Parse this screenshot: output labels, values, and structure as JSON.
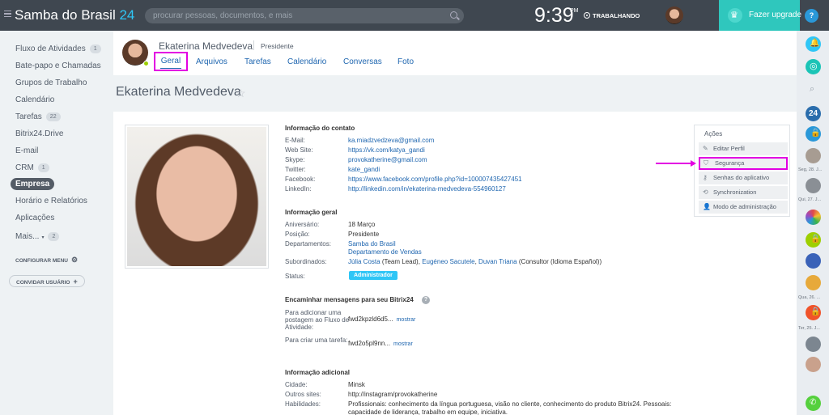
{
  "header": {
    "logo_text": "Samba do Brasil",
    "logo_number": "24",
    "search_placeholder": "procurar pessoas, documentos, e mais",
    "time": "9:39",
    "ampm": "PM",
    "work_status": "TRABALHANDO",
    "upgrade_label": "Fazer upgrade",
    "help_label": "?"
  },
  "sidebar": {
    "items": [
      {
        "label": "Fluxo de Atividades",
        "count": "1"
      },
      {
        "label": "Bate-papo e Chamadas"
      },
      {
        "label": "Grupos de Trabalho"
      },
      {
        "label": "Calendário"
      },
      {
        "label": "Tarefas",
        "count": "22"
      },
      {
        "label": "Bitrix24.Drive"
      },
      {
        "label": "E-mail"
      },
      {
        "label": "CRM",
        "count": "1"
      },
      {
        "label": "Empresa"
      },
      {
        "label": "Horário e Relatórios"
      },
      {
        "label": "Aplicações"
      },
      {
        "label": "Mais...",
        "count": "2"
      }
    ],
    "configure_label": "CONFIGURAR MENU",
    "invite_label": "CONVIDAR USUÁRIO"
  },
  "profile": {
    "name": "Ekaterina Medvedeva",
    "position": "Presidente",
    "tabs": [
      "Geral",
      "Arquivos",
      "Tarefas",
      "Calendário",
      "Conversas",
      "Foto"
    ],
    "title": "Ekaterina Medvedeva"
  },
  "contact": {
    "title": "Informação do contato",
    "rows": [
      {
        "label": "E-Mail:",
        "value": "ka.miadzvedzeva@gmail.com"
      },
      {
        "label": "Web Site:",
        "value": "https://vk.com/katya_gandi"
      },
      {
        "label": "Skype:",
        "value": "provokatherine@gmail.com"
      },
      {
        "label": "Twitter:",
        "value": "kate_gandi"
      },
      {
        "label": "Facebook:",
        "value": "https://www.facebook.com/profile.php?id=100007435427451"
      },
      {
        "label": "LinkedIn:",
        "value": "http://linkedin.com/in/ekaterina-medvedeva-554960127"
      }
    ]
  },
  "general": {
    "title": "Informação geral",
    "birthday_label": "Aniversário:",
    "birthday": "18 Março",
    "position_label": "Posição:",
    "position": "Presidente",
    "departments_label": "Departamentos:",
    "departments": [
      "Samba do Brasil",
      "Departamento de Vendas"
    ],
    "subordinates_label": "Subordinados:",
    "subordinates": [
      "Júlia Costa",
      "(Team Lead),",
      "Eugéneo Sacutele",
      ",",
      "Duvan Triana",
      "(Consultor (Idioma Español))"
    ],
    "status_label": "Status:",
    "status": "Administrador"
  },
  "forward": {
    "title": "Encaminhar mensagens para seu Bitrix24",
    "rows": [
      {
        "label": "Para adicionar uma postagem ao Fluxo de Atividade:",
        "code": "fwd2kpzld6d5...",
        "link": "mostrar"
      },
      {
        "label": "Para criar uma tarefa:",
        "code": "fwd2o5pl9nn...",
        "link": "mostrar"
      }
    ]
  },
  "additional": {
    "title": "Informação adicional",
    "city_label": "Cidade:",
    "city": "Minsk",
    "sites_label": "Outros sites:",
    "sites": "http://instagram/provokatherine",
    "skills_label": "Habilidades:",
    "skills_line1": "Profissionais: conhecimento da língua portuguesa, visão no cliente, conhecimento do produto Bitrix24. Pessoais:",
    "skills_line2": "capacidade de liderança, trabalho em equipe, iniciativa."
  },
  "actions": {
    "title": "Ações",
    "items": [
      "Editar Perfil",
      "Segurança",
      "Senhas do aplicativo",
      "Synchronization",
      "Modo de administração"
    ]
  },
  "right_bar": {
    "labels": [
      "Seg, 28. J...",
      "Qui, 27. J...",
      "Qua, 26. ...",
      "Ter, 25. J..."
    ],
    "counter": "24"
  },
  "colors": {
    "header_bg": "#3f4750",
    "accent": "#2fc6f6",
    "upgrade": "#2fc7bd",
    "highlight": "#e200e2",
    "link": "#2067b0"
  }
}
